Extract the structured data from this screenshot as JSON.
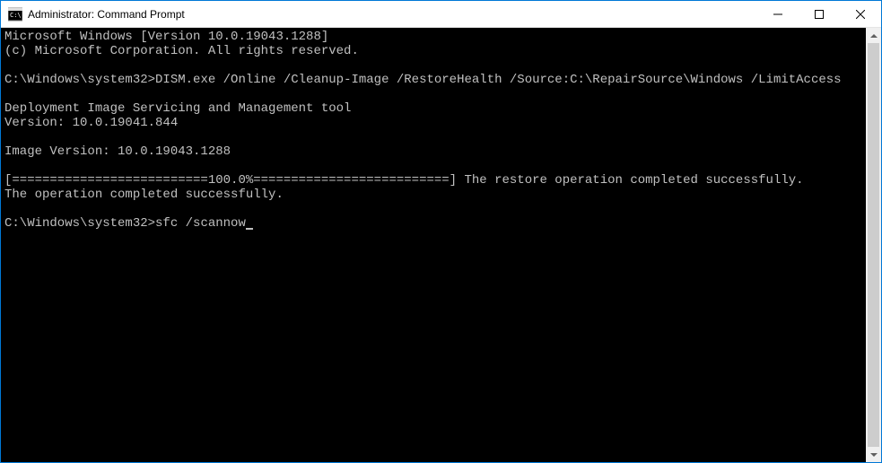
{
  "titlebar": {
    "title": "Administrator: Command Prompt"
  },
  "terminal": {
    "line1": "Microsoft Windows [Version 10.0.19043.1288]",
    "line2": "(c) Microsoft Corporation. All rights reserved.",
    "blank1": "",
    "prompt1": "C:\\Windows\\system32>",
    "cmd1": "DISM.exe /Online /Cleanup-Image /RestoreHealth /Source:C:\\RepairSource\\Windows /LimitAccess",
    "blank2": "",
    "line3": "Deployment Image Servicing and Management tool",
    "line4": "Version: 10.0.19041.844",
    "blank3": "",
    "line5": "Image Version: 10.0.19043.1288",
    "blank4": "",
    "progress": "[==========================100.0%==========================] The restore operation completed successfully.",
    "line6": "The operation completed successfully.",
    "blank5": "",
    "prompt2": "C:\\Windows\\system32>",
    "cmd2": "sfc /scannow"
  }
}
